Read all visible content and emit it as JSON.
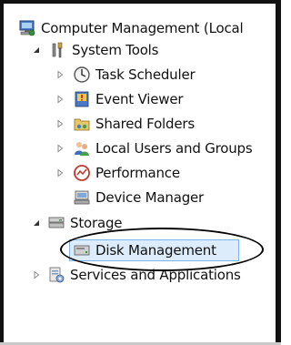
{
  "tree": {
    "root": {
      "label": "Computer Management (Local"
    },
    "system_tools": {
      "label": "System Tools"
    },
    "task_scheduler": {
      "label": "Task Scheduler"
    },
    "event_viewer": {
      "label": "Event Viewer"
    },
    "shared_folders": {
      "label": "Shared Folders"
    },
    "local_users": {
      "label": "Local Users and Groups"
    },
    "performance": {
      "label": "Performance"
    },
    "device_manager": {
      "label": "Device Manager"
    },
    "storage": {
      "label": "Storage"
    },
    "disk_management": {
      "label": "Disk Management"
    },
    "services": {
      "label": "Services and Applications"
    }
  },
  "colors": {
    "selection_bg": "#dcecfb",
    "selection_border": "#7eb4ea",
    "annotation": "#000000"
  }
}
